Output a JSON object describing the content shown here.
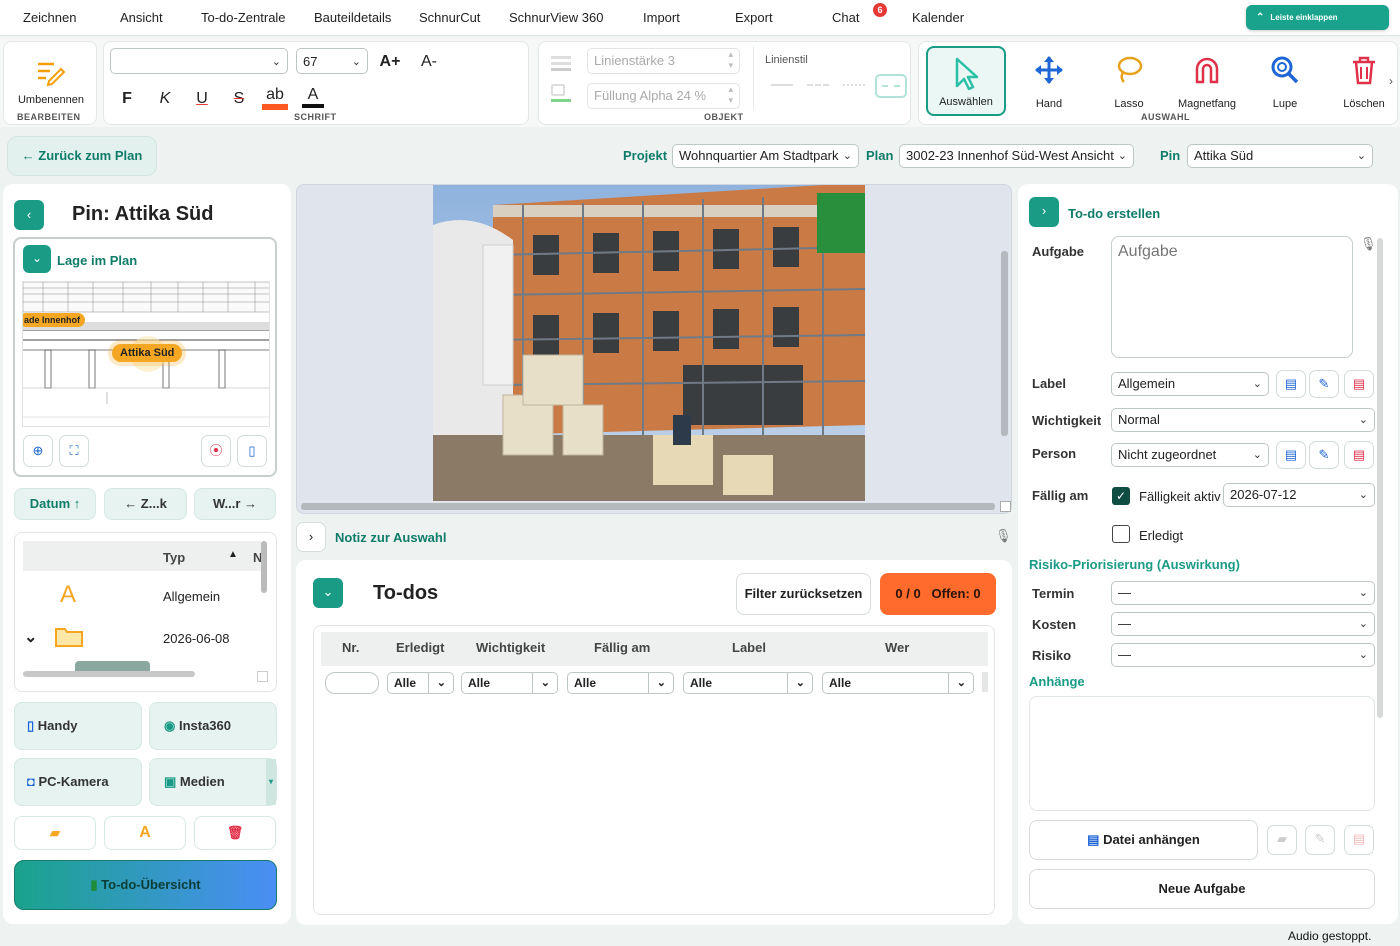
{
  "menu": {
    "items": [
      "Zeichnen",
      "Ansicht",
      "To-do-Zentrale",
      "Bauteildetails",
      "SchnurCut",
      "SchnurView 360",
      "Import",
      "Export",
      "Chat",
      "Kalender"
    ],
    "chat_badge": "6",
    "collapse_label": "Leiste einklappen"
  },
  "ribbon": {
    "edit": {
      "rename_label": "Umbenennen",
      "group_label": "BEARBEITEN"
    },
    "font": {
      "family_value": "",
      "size_value": "67",
      "grow": "A+",
      "shrink": "A-",
      "bold": "F",
      "italic": "K",
      "underline": "U",
      "strike": "S",
      "highlight": "ab",
      "color": "A",
      "group_label": "SCHRIFT",
      "highlight_color": "#ff5722"
    },
    "object": {
      "line_width": "Linienstärke 3",
      "fill_alpha": "Füllung Alpha 24 %",
      "line_style_label": "Linienstil",
      "group_label": "OBJEKT"
    },
    "selection": {
      "tools": [
        {
          "label": "Auswählen",
          "icon": "cursor-icon",
          "active": true
        },
        {
          "label": "Hand",
          "icon": "move-icon"
        },
        {
          "label": "Lasso",
          "icon": "lasso-icon"
        },
        {
          "label": "Magnetfang",
          "icon": "magnet-icon"
        },
        {
          "label": "Lupe",
          "icon": "magnifier-icon"
        },
        {
          "label": "Löschen",
          "icon": "trash-icon"
        }
      ],
      "group_label": "AUSWAHL"
    }
  },
  "nav": {
    "back_label": "← Zurück zum Plan",
    "project_label": "Projekt",
    "project_value": "Wohnquartier Am Stadtpark",
    "plan_label": "Plan",
    "plan_value": "3002-23 Innenhof Süd-West Ansicht",
    "pin_label": "Pin",
    "pin_value": "Attika Süd"
  },
  "left": {
    "title": "Pin: Attika Süd",
    "location_label": "Lage im Plan",
    "plan_tag_1": "ade Innenhof",
    "plan_tag_2": "Attika Süd",
    "sort_date": "Datum ↑",
    "sort_prev": "← Z...k",
    "sort_next": "W...r →",
    "tree_header": "Typ",
    "tree_header_2": "N",
    "tree_rows": [
      {
        "icon": "A",
        "label": "Allgemein"
      },
      {
        "icon": "folder",
        "label": "2026-06-08"
      }
    ],
    "buttons": {
      "handy": "Handy",
      "insta": "Insta360",
      "pc_cam": "PC-Kamera",
      "media": "Medien",
      "overview": "To-do-Übersicht"
    }
  },
  "center": {
    "note_label": "Notiz zur Auswahl",
    "todos_title": "To-dos",
    "reset_filter": "Filter zurücksetzen",
    "count_badge": "0 / 0   Offen: 0",
    "columns": [
      "Nr.",
      "Erledigt",
      "Wichtigkeit",
      "Fällig am",
      "Label",
      "Wer"
    ],
    "filter_values": [
      "",
      "Alle",
      "Alle",
      "Alle",
      "Alle",
      "Alle"
    ]
  },
  "right": {
    "header": "To-do erstellen",
    "task_label": "Aufgabe",
    "task_placeholder": "Aufgabe",
    "label_label": "Label",
    "label_value": "Allgemein",
    "priority_label": "Wichtigkeit",
    "priority_value": "Normal",
    "person_label": "Person",
    "person_value": "Nicht zugeordnet",
    "due_label": "Fällig am",
    "due_active_label": "Fälligkeit aktiv",
    "due_value": "2026-07-12",
    "done_label": "Erledigt",
    "risk_header": "Risiko-Priorisierung (Auswirkung)",
    "risk_rows": [
      {
        "label": "Termin",
        "value": "—"
      },
      {
        "label": "Kosten",
        "value": "—"
      },
      {
        "label": "Risiko",
        "value": "—"
      }
    ],
    "attachments_label": "Anhänge",
    "attach_button": "Datei anhängen",
    "new_task_button": "Neue Aufgabe"
  },
  "status": "Audio gestoppt.",
  "colors": {
    "accent": "#1a9b85",
    "orange": "#ff6b2c",
    "brand_dark": "#0f7c69"
  }
}
